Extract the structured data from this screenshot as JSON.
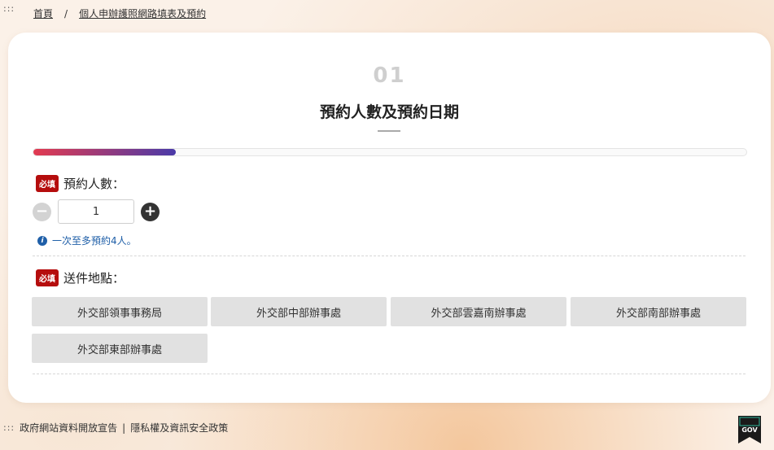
{
  "accesskeys": {
    "top": ":::",
    "bottom": ":::"
  },
  "breadcrumb": {
    "home": "首頁",
    "separator": "/",
    "current": "個人申辦護照網路填表及預約"
  },
  "step": {
    "number": "01",
    "title": "預約人數及預約日期",
    "progress_fraction": 0.2
  },
  "people": {
    "required_badge": "必填",
    "label": "預約人數：",
    "value": "1",
    "minus": "−",
    "plus": "+",
    "hint_icon": "i",
    "hint": "一次至多預約4人。"
  },
  "location": {
    "required_badge": "必填",
    "label": "送件地點：",
    "options": [
      "外交部領事事務局",
      "外交部中部辦事處",
      "外交部雲嘉南辦事處",
      "外交部南部辦事處",
      "外交部東部辦事處"
    ]
  },
  "footer": {
    "open_data": "政府網站資料開放宣告",
    "divider": "|",
    "privacy": "隱私權及資訊安全政策",
    "gov_badge": "GOV"
  }
}
